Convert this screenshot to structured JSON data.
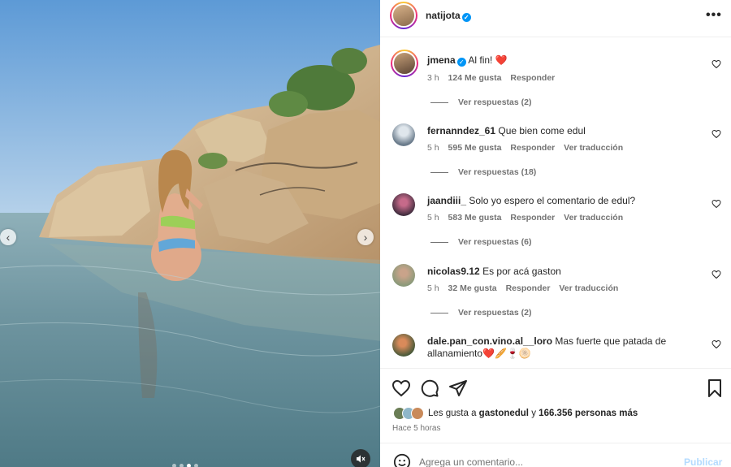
{
  "post": {
    "owner": "natijota",
    "more_label": "•••"
  },
  "comments": [
    {
      "user": "jmena",
      "verified": true,
      "text": "Al fin! ❤️",
      "time": "3 h",
      "likes": "124 Me gusta",
      "reply_label": "Responder",
      "translate_label": "",
      "replies_label": "Ver respuestas (2)"
    },
    {
      "user": "fernanndez_61",
      "verified": false,
      "text": "Que bien come edul",
      "time": "5 h",
      "likes": "595 Me gusta",
      "reply_label": "Responder",
      "translate_label": "Ver traducción",
      "replies_label": "Ver respuestas (18)"
    },
    {
      "user": "jaandiii_",
      "verified": false,
      "text": "Solo yo espero el comentario de edul?",
      "time": "5 h",
      "likes": "583 Me gusta",
      "reply_label": "Responder",
      "translate_label": "Ver traducción",
      "replies_label": "Ver respuestas (6)"
    },
    {
      "user": "nicolas9.12",
      "verified": false,
      "text": "Es por acá gaston",
      "time": "5 h",
      "likes": "32 Me gusta",
      "reply_label": "Responder",
      "translate_label": "Ver traducción",
      "replies_label": "Ver respuestas (2)"
    },
    {
      "user": "dale.pan_con.vino.al__loro",
      "verified": false,
      "text": "Mas fuerte que patada de allanamiento❤️🥖🍷🫓"
    }
  ],
  "likes_summary": {
    "prefix": "Les gusta a",
    "first_user": "gastonedul",
    "connector": "y",
    "others": "166.356 personas más"
  },
  "time_ago": "Hace 5 horas",
  "add_comment": {
    "placeholder": "Agrega un comentario...",
    "publish_label": "Publicar"
  },
  "colors": {
    "accent": "#0095f6",
    "like_red": "#ed4956",
    "text_primary": "#262626",
    "text_secondary": "#737373"
  },
  "icons": {
    "like": "heart-icon",
    "comment": "comment-icon",
    "share": "share-icon",
    "save": "bookmark-icon",
    "mute": "muted-speaker-icon",
    "emoji": "emoji-icon",
    "more": "more-options-icon"
  },
  "carousel": {
    "slides": 4,
    "active": 2
  }
}
